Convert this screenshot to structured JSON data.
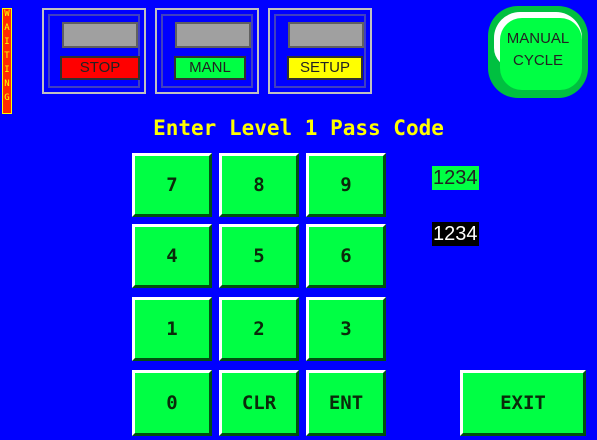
{
  "status": {
    "text": "WAITING",
    "letters": [
      "W",
      "A",
      "I",
      "T",
      "I",
      "N",
      "G"
    ]
  },
  "modes": [
    {
      "label": "STOP",
      "bg": "#ff0000",
      "fg": "#222222"
    },
    {
      "label": "MANL",
      "bg": "#00ff44",
      "fg": "#222222"
    },
    {
      "label": "SETUP",
      "bg": "#ffff00",
      "fg": "#222222"
    }
  ],
  "manual_cycle": {
    "line1": "MANUAL",
    "line2": "CYCLE"
  },
  "title": "Enter Level 1 Pass Code",
  "keypad": {
    "row1": [
      "7",
      "8",
      "9"
    ],
    "row2": [
      "4",
      "5",
      "6"
    ],
    "row3": [
      "1",
      "2",
      "3"
    ],
    "row4": [
      "0",
      "CLR",
      "ENT"
    ],
    "exit": "EXIT"
  },
  "codes": {
    "entered": "1234",
    "entered_bg": "#00ff44",
    "entered_fg": "#222222",
    "expected": "1234",
    "expected_bg": "#000000",
    "expected_fg": "#ffffff"
  },
  "colors": {
    "screen_bg": "#0000ff",
    "key_bg": "#00ff44",
    "title": "#ffff00"
  }
}
